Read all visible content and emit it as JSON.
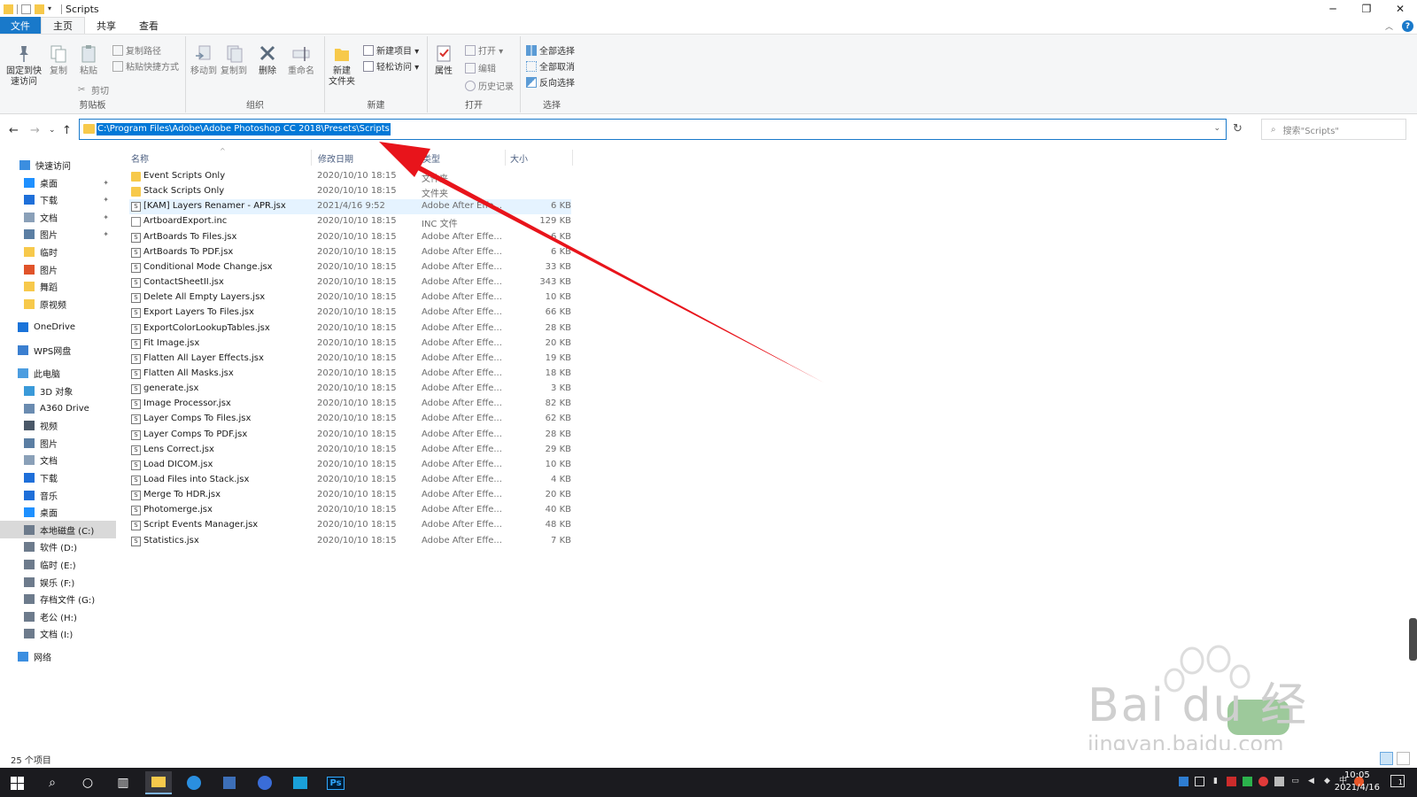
{
  "window": {
    "title": "Scripts"
  },
  "tabs": {
    "file": "文件",
    "home": "主页",
    "share": "共享",
    "view": "查看"
  },
  "ribbon": {
    "clipboard": {
      "label": "剪贴板",
      "pin": "固定到快\n速访问",
      "copy": "复制",
      "paste": "粘贴",
      "copy_path": "复制路径",
      "paste_shortcut": "粘贴快捷方式",
      "cut": "剪切"
    },
    "organize": {
      "label": "组织",
      "move_to": "移动到",
      "copy_to": "复制到",
      "delete": "删除",
      "rename": "重命名"
    },
    "new": {
      "label": "新建",
      "new_folder": "新建\n文件夹",
      "new_item": "新建项目 ▾",
      "easy_access": "轻松访问 ▾"
    },
    "open": {
      "label": "打开",
      "properties": "属性",
      "open": "打开 ▾",
      "edit": "编辑",
      "history": "历史记录"
    },
    "select": {
      "label": "选择",
      "select_all": "全部选择",
      "select_none": "全部取消",
      "invert": "反向选择"
    }
  },
  "address": {
    "path": "C:\\Program Files\\Adobe\\Adobe Photoshop CC 2018\\Presets\\Scripts"
  },
  "search": {
    "placeholder": "搜索\"Scripts\""
  },
  "sidebar": {
    "quick_access": "快速访问",
    "items": [
      {
        "label": "桌面",
        "pinned": true,
        "icon": "desktop-icon",
        "color": "#1e90ff"
      },
      {
        "label": "下载",
        "pinned": true,
        "icon": "download-icon",
        "color": "#1e6fd9"
      },
      {
        "label": "文档",
        "pinned": true,
        "icon": "document-icon",
        "color": "#8aa0b8"
      },
      {
        "label": "图片",
        "pinned": true,
        "icon": "pictures-icon",
        "color": "#5b7ea3"
      },
      {
        "label": "临时",
        "pinned": false,
        "icon": "folder-icon",
        "color": "#f7c94b"
      },
      {
        "label": "图片",
        "pinned": false,
        "icon": "photos-app-icon",
        "color": "#e0532a"
      },
      {
        "label": "舞蹈",
        "pinned": false,
        "icon": "folder-icon",
        "color": "#f7c94b"
      },
      {
        "label": "原视频",
        "pinned": false,
        "icon": "folder-icon",
        "color": "#f7c94b"
      }
    ],
    "onedrive": "OneDrive",
    "wps": "WPS网盘",
    "this_pc": "此电脑",
    "pc_items": [
      {
        "label": "3D 对象",
        "icon": "3d-objects-icon",
        "color": "#3a9ad9"
      },
      {
        "label": "A360 Drive",
        "icon": "a360-drive-icon",
        "color": "#6a8bb0"
      },
      {
        "label": "视频",
        "icon": "videos-icon",
        "color": "#4a5868"
      },
      {
        "label": "图片",
        "icon": "pictures-icon",
        "color": "#5b7ea3"
      },
      {
        "label": "文档",
        "icon": "document-icon",
        "color": "#8aa0b8"
      },
      {
        "label": "下载",
        "icon": "download-icon",
        "color": "#1e6fd9"
      },
      {
        "label": "音乐",
        "icon": "music-icon",
        "color": "#1e6fd9"
      },
      {
        "label": "桌面",
        "icon": "desktop-icon",
        "color": "#1e90ff"
      },
      {
        "label": "本地磁盘 (C:)",
        "icon": "drive-c-icon",
        "color": "#6d7b8c"
      },
      {
        "label": "软件 (D:)",
        "icon": "drive-icon",
        "color": "#6d7b8c"
      },
      {
        "label": "临时 (E:)",
        "icon": "drive-icon",
        "color": "#6d7b8c"
      },
      {
        "label": "娱乐 (F:)",
        "icon": "drive-icon",
        "color": "#6d7b8c"
      },
      {
        "label": "存档文件 (G:)",
        "icon": "drive-icon",
        "color": "#6d7b8c"
      },
      {
        "label": "老公 (H:)",
        "icon": "drive-icon",
        "color": "#6d7b8c"
      },
      {
        "label": "文档 (I:)",
        "icon": "drive-icon",
        "color": "#6d7b8c"
      }
    ],
    "network": "网络"
  },
  "columns": {
    "name": "名称",
    "date": "修改日期",
    "type": "类型",
    "size": "大小"
  },
  "files": [
    {
      "name": "Event Scripts Only",
      "date": "2020/10/10 18:15",
      "type": "文件夹",
      "size": "",
      "kind": "folder"
    },
    {
      "name": "Stack Scripts Only",
      "date": "2020/10/10 18:15",
      "type": "文件夹",
      "size": "",
      "kind": "folder"
    },
    {
      "name": "[KAM] Layers Renamer - APR.jsx",
      "date": "2021/4/16 9:52",
      "type": "Adobe After Effe...",
      "size": "6 KB",
      "kind": "jsx"
    },
    {
      "name": "ArtboardExport.inc",
      "date": "2020/10/10 18:15",
      "type": "INC 文件",
      "size": "129 KB",
      "kind": "file"
    },
    {
      "name": "ArtBoards To Files.jsx",
      "date": "2020/10/10 18:15",
      "type": "Adobe After Effe...",
      "size": "6 KB",
      "kind": "jsx"
    },
    {
      "name": "ArtBoards To PDF.jsx",
      "date": "2020/10/10 18:15",
      "type": "Adobe After Effe...",
      "size": "6 KB",
      "kind": "jsx"
    },
    {
      "name": "Conditional Mode Change.jsx",
      "date": "2020/10/10 18:15",
      "type": "Adobe After Effe...",
      "size": "33 KB",
      "kind": "jsx"
    },
    {
      "name": "ContactSheetII.jsx",
      "date": "2020/10/10 18:15",
      "type": "Adobe After Effe...",
      "size": "343 KB",
      "kind": "jsx"
    },
    {
      "name": "Delete All Empty Layers.jsx",
      "date": "2020/10/10 18:15",
      "type": "Adobe After Effe...",
      "size": "10 KB",
      "kind": "jsx"
    },
    {
      "name": "Export Layers To Files.jsx",
      "date": "2020/10/10 18:15",
      "type": "Adobe After Effe...",
      "size": "66 KB",
      "kind": "jsx"
    },
    {
      "name": "ExportColorLookupTables.jsx",
      "date": "2020/10/10 18:15",
      "type": "Adobe After Effe...",
      "size": "28 KB",
      "kind": "jsx"
    },
    {
      "name": "Fit Image.jsx",
      "date": "2020/10/10 18:15",
      "type": "Adobe After Effe...",
      "size": "20 KB",
      "kind": "jsx"
    },
    {
      "name": "Flatten All Layer Effects.jsx",
      "date": "2020/10/10 18:15",
      "type": "Adobe After Effe...",
      "size": "19 KB",
      "kind": "jsx"
    },
    {
      "name": "Flatten All Masks.jsx",
      "date": "2020/10/10 18:15",
      "type": "Adobe After Effe...",
      "size": "18 KB",
      "kind": "jsx"
    },
    {
      "name": "generate.jsx",
      "date": "2020/10/10 18:15",
      "type": "Adobe After Effe...",
      "size": "3 KB",
      "kind": "jsx"
    },
    {
      "name": "Image Processor.jsx",
      "date": "2020/10/10 18:15",
      "type": "Adobe After Effe...",
      "size": "82 KB",
      "kind": "jsx"
    },
    {
      "name": "Layer Comps To Files.jsx",
      "date": "2020/10/10 18:15",
      "type": "Adobe After Effe...",
      "size": "62 KB",
      "kind": "jsx"
    },
    {
      "name": "Layer Comps To PDF.jsx",
      "date": "2020/10/10 18:15",
      "type": "Adobe After Effe...",
      "size": "28 KB",
      "kind": "jsx"
    },
    {
      "name": "Lens Correct.jsx",
      "date": "2020/10/10 18:15",
      "type": "Adobe After Effe...",
      "size": "29 KB",
      "kind": "jsx"
    },
    {
      "name": "Load DICOM.jsx",
      "date": "2020/10/10 18:15",
      "type": "Adobe After Effe...",
      "size": "10 KB",
      "kind": "jsx"
    },
    {
      "name": "Load Files into Stack.jsx",
      "date": "2020/10/10 18:15",
      "type": "Adobe After Effe...",
      "size": "4 KB",
      "kind": "jsx"
    },
    {
      "name": "Merge To HDR.jsx",
      "date": "2020/10/10 18:15",
      "type": "Adobe After Effe...",
      "size": "20 KB",
      "kind": "jsx"
    },
    {
      "name": "Photomerge.jsx",
      "date": "2020/10/10 18:15",
      "type": "Adobe After Effe...",
      "size": "40 KB",
      "kind": "jsx"
    },
    {
      "name": "Script Events Manager.jsx",
      "date": "2020/10/10 18:15",
      "type": "Adobe After Effe...",
      "size": "48 KB",
      "kind": "jsx"
    },
    {
      "name": "Statistics.jsx",
      "date": "2020/10/10 18:15",
      "type": "Adobe After Effe...",
      "size": "7 KB",
      "kind": "jsx"
    }
  ],
  "status": {
    "count": "25 个项目"
  },
  "taskbar": {
    "apps": [
      "windows-start-icon",
      "search-icon",
      "cortana-icon",
      "task-view-icon",
      "file-explorer-icon",
      "edge-icon",
      "app-icon",
      "baidu-netdisk-icon",
      "app-icon",
      "photoshop-icon"
    ],
    "ps_label": "Ps",
    "ime": "中",
    "time": "10:05",
    "date": "2021/4/16",
    "notif_count": "1"
  },
  "watermark": {
    "text": "Bai du 经验",
    "url": "jingyan.baidu.com"
  },
  "colors": {
    "accent": "#1979ca",
    "selection": "#0078d7",
    "arrow": "#e8141b",
    "hover_row": "#e5f3ff"
  }
}
